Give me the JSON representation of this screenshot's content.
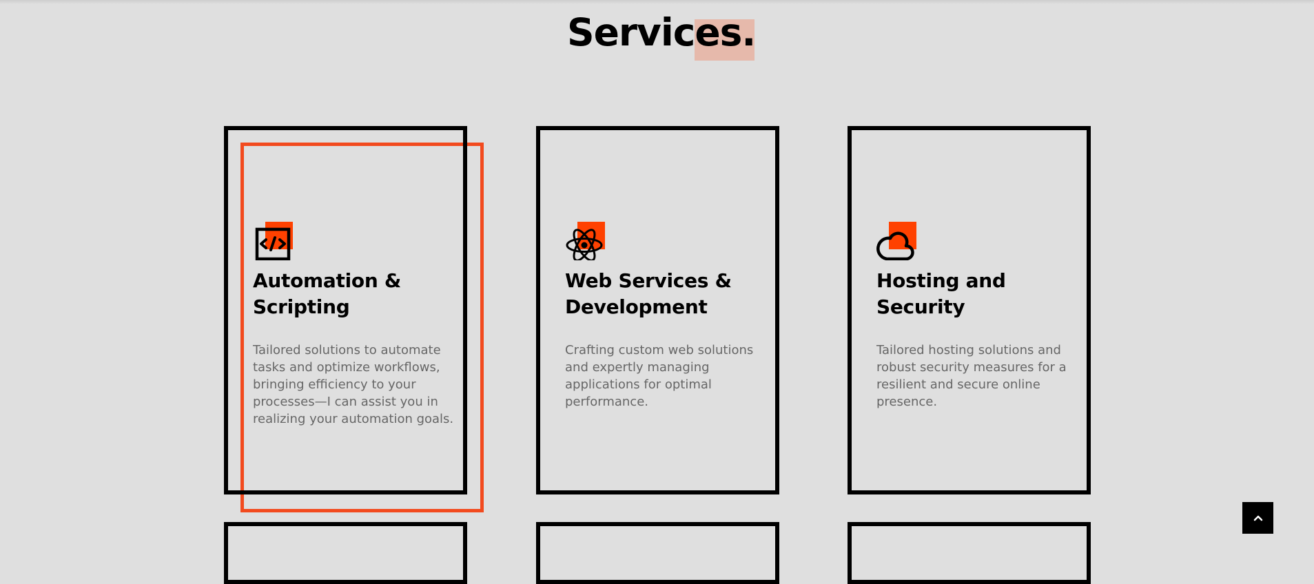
{
  "section": {
    "title": "Services."
  },
  "colors": {
    "accent": "#ff4100",
    "accent_outline": "#f24a1e",
    "title_highlight": "#e6b9ab",
    "background": "#dfdfdf",
    "text": "#000000",
    "muted_text": "#666666"
  },
  "cards": [
    {
      "icon": "code-icon",
      "title": "Automation & Scripting",
      "description": "Tailored solutions to automate tasks and optimize workflows, bringing efficiency to your processes—I can assist you in realizing your automation goals."
    },
    {
      "icon": "react-atom-icon",
      "title": "Web Services & Development",
      "description": "Crafting custom web solutions and expertly managing applications for optimal performance."
    },
    {
      "icon": "cloud-icon",
      "title": "Hosting and Security",
      "description": "Tailored hosting solutions and robust security measures for a resilient and secure online presence."
    }
  ],
  "scroll_to_top": {
    "icon": "chevron-up-icon"
  }
}
